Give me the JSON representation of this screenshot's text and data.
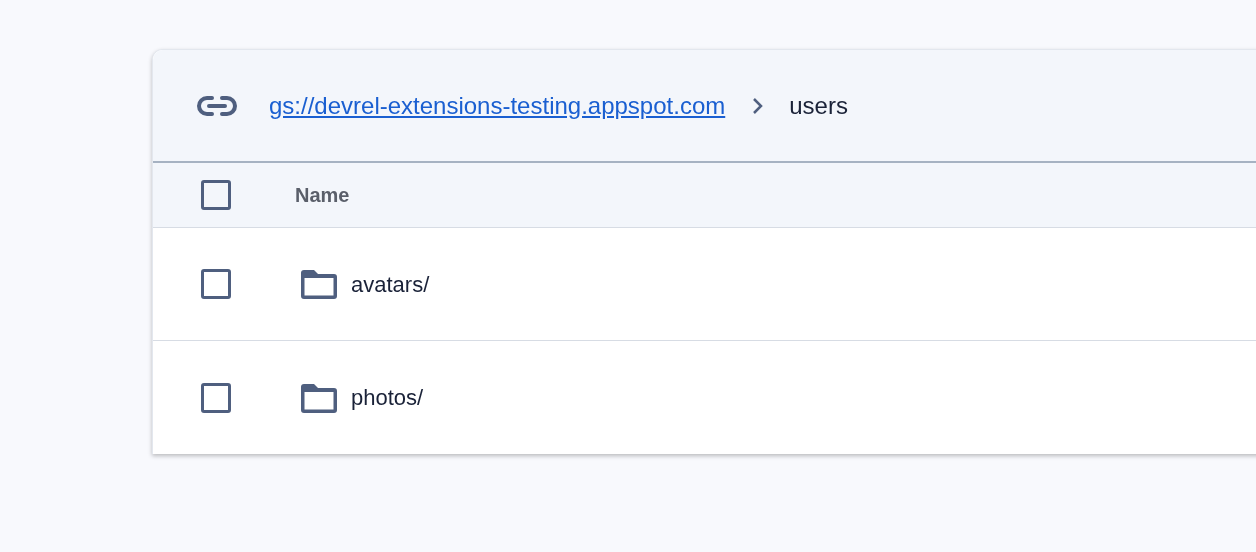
{
  "breadcrumb": {
    "link": "gs://devrel-extensions-testing.appspot.com",
    "current": "users"
  },
  "table": {
    "select_all": {
      "checked": false
    },
    "columns": [
      "Name"
    ],
    "rows": [
      {
        "name": "avatars/",
        "kind": "folder",
        "checked": false
      },
      {
        "name": "photos/",
        "kind": "folder",
        "checked": false
      }
    ]
  }
}
